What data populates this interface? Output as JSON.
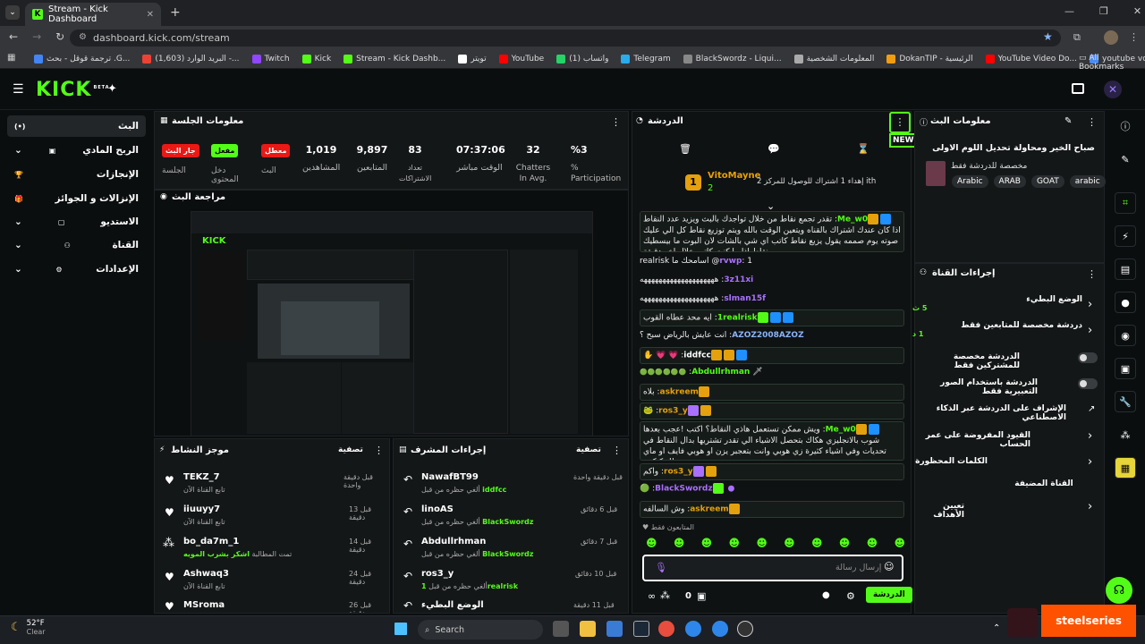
{
  "browser": {
    "tab_title": "Stream - Kick Dashboard",
    "url": "dashboard.kick.com/stream",
    "bookmarks": [
      "ترجمة قوقل - بحث .G...",
      "البريد الوارد (1,603) -...",
      "Twitch",
      "Kick",
      "Stream - Kick Dashb...",
      "تويتر",
      "YouTube",
      "واتساب (1)",
      "Telegram",
      "BlackSwordz - Liqui...",
      "المعلومات الشخصية",
      "DokanTIP - الرئيسية",
      "YouTube Video Do...",
      "youtube vod"
    ],
    "all_bookmarks": "All Bookmarks"
  },
  "brand": {
    "logo": "KICK",
    "beta": "BETA",
    "accent": "#53fc18"
  },
  "nav": {
    "items": [
      {
        "label": "البث",
        "icon": "(•)"
      },
      {
        "label": "الربح المادي",
        "icon": "▣"
      },
      {
        "label": "الإنجازات",
        "icon": "🏆"
      },
      {
        "label": "الإنزالات و الجوائز",
        "icon": "🎁"
      },
      {
        "label": "الاستديو",
        "icon": "▢"
      },
      {
        "label": "القناة",
        "icon": "⚇"
      },
      {
        "label": "الإعدادات",
        "icon": "⚙"
      }
    ]
  },
  "session": {
    "title": "معلومات الجلسة",
    "btn_live": "جار البث",
    "btn_enabled": "مفعل",
    "btn_disabled": "معطل",
    "labels": [
      "الجلسة",
      "دخل المحتوى",
      "البث"
    ],
    "stats": [
      {
        "value": "1,019",
        "label": "المشاهدين"
      },
      {
        "value": "9,897",
        "label": "المتابعين"
      },
      {
        "value": "83",
        "label": "تعداد الاشتراكات"
      },
      {
        "value": "07:37:06",
        "label": "الوقت مباشر"
      },
      {
        "value": "32",
        "label": "Chatters In Avg."
      },
      {
        "value": "%3",
        "label": "% Participation"
      }
    ]
  },
  "preview": {
    "title": "مراجعة البث"
  },
  "activity": {
    "title": "موجز النشاط",
    "filter": "تصفية",
    "rows": [
      {
        "name": "TEKZ_7",
        "sub": "تابع القناة الآن",
        "time": "قبل دقيقة واحدة",
        "icon": "heart-icon"
      },
      {
        "name": "iiuuyy7",
        "sub": "تابع القناة الآن",
        "time": "قبل 13 دقيقة",
        "icon": "heart-icon"
      },
      {
        "name": "bo_da7m_1",
        "sub": "تمت المطالبة",
        "sub2": "اشكر بشرب المويه",
        "time": "قبل 14 دقيقة",
        "icon": "dots-icon"
      },
      {
        "name": "Ashwaq3",
        "sub": "تابع القناة الآن",
        "time": "قبل 24 دقيقة",
        "icon": "heart-icon"
      },
      {
        "name": "MSroma",
        "sub": "",
        "time": "قبل 26 دقيقة",
        "icon": "heart-icon"
      }
    ]
  },
  "mod": {
    "title": "إجراءات المشرف",
    "filter": "تصفية",
    "rows": [
      {
        "name": "NawafBT99",
        "sub": "ألغي حظره من قبل",
        "by": "iddfcc",
        "time": "قبل دقيقة واحدة"
      },
      {
        "name": "linoAS",
        "sub": "ألغي حظره من قبل",
        "by": "BlackSwordz",
        "time": "قبل 6 دقائق"
      },
      {
        "name": "Abdullrhman",
        "sub": "ألغي حظره من قبل",
        "by": "BlackSwordz",
        "time": "قبل 7 دقائق"
      },
      {
        "name": "ros3_y",
        "sub": "ألغي حظره من قبل",
        "by": "1realrisk",
        "time": "قبل 10 دقائق"
      },
      {
        "name": "الوضع البطيء",
        "sub": "",
        "by": "",
        "time": "قبل 11 دقيقة"
      }
    ]
  },
  "chat": {
    "title": "الدردشة",
    "new_label": "NEW",
    "pinned_user": "VitoMayne",
    "pinned_count": "2",
    "pinned_text": "إهداء 1 اشتراك للوصول للمركز 2 ith",
    "messages": [
      {
        "user": "Me_w0",
        "color": "#53fc18",
        "text": "تقدر تجمع نقاط من خلال تواجدك بالبث ويزيد عدد النقاط اذا كان عندك اشتراك بالقناه ويتعين الوقت بالله ويتم توزيع نقاط كل الي عليك صوته يوم صممه يقول يزيع نقاط كاتب اي شي بالشات لان البوت ما بيسطيك نقاط اذا ما كنت كاتب خلال اخر دقيقة",
        "hl": true
      },
      {
        "user": "rvwp",
        "color": "#a970ff",
        "text": "1@ اسامحك ما realrisk"
      },
      {
        "user": "3z11xi",
        "color": "#a970ff",
        "text": "ههههههههههههههههههههه"
      },
      {
        "user": "slman15f",
        "color": "#a970ff",
        "text": "ههههههههههههههههههههه"
      },
      {
        "user": "1realrisk",
        "color": "#53fc18",
        "text": "ايه محد عطاه القوب",
        "hl": true
      },
      {
        "user": "AZOZ2008AZOZ",
        "color": "#a970ff",
        "text": "انت عايش بالرياض سبح ؟"
      },
      {
        "user": "iddfcc",
        "color": "#ffffff",
        "text": "💗 💗 ✋",
        "hl": true
      },
      {
        "user": "Abdullrhman",
        "color": "#53fc18",
        "text": "🟢🟢🟢🟢🟢🟢"
      },
      {
        "user": "askreem",
        "color": "#e5a00d",
        "text": "بلاه",
        "hl": true
      },
      {
        "user": "ros3_y",
        "color": "#e5a00d",
        "text": "🐸",
        "hl": true
      },
      {
        "user": "Me_w0",
        "color": "#53fc18",
        "text": "ويش ممكن تستعمل هاذي النقاط؟ اكتب !عجب بعدها شوب بالانجليزي هكاك بتحصل الاشياء الي تقدر تشتريها بدال النقاط في تحديات وفي اشياء كثيرة زي هوبي وانت بتعجبر يزن او هوبي فايف او ماي سطل كتكتي",
        "hl": true
      },
      {
        "user": "ros3_y",
        "color": "#e5a00d",
        "text": "واكم",
        "hl": true
      },
      {
        "user": "BlackSwordz",
        "color": "#a970ff",
        "text": "🟢"
      },
      {
        "user": "askreem",
        "color": "#e5a00d",
        "text": "وش السالفه",
        "hl": true
      }
    ],
    "followers_only": "المتابعون فقط",
    "input_placeholder": "إرسال رسالة",
    "send_label": "الدردشة",
    "count": "0"
  },
  "stream_info": {
    "title": "معلومات البث",
    "stream_title": "صباح الخير ومحاولة تحديل اللوم الاولى",
    "category": "مخصصة للدردشة فقط",
    "tags": [
      "Arabic",
      "ARAB",
      "GOAT",
      "arabic"
    ]
  },
  "channel_actions": {
    "title": "إجراءات القناة",
    "items": [
      {
        "label": "الوضع البطيء",
        "sub": "5 ث",
        "control": "chevron"
      },
      {
        "label": "دردشة مخصصة للمتابعين فقط",
        "sub": "1 د",
        "control": "chevron"
      },
      {
        "label": "الدردشة مخصصة للمشتركين فقط",
        "sub": "",
        "control": "toggle"
      },
      {
        "label": "الدردشة باستخدام الصور التعبيرية فقط",
        "sub": "",
        "control": "toggle"
      },
      {
        "label": "الإشراف على الدردشة عبر الذكاء الاصطناعي",
        "sub": "",
        "control": "external"
      },
      {
        "label": "القيود المفروضة على عمر الحساب",
        "sub": "",
        "control": "chevron"
      },
      {
        "label": "الكلمات المحظورة",
        "sub": "",
        "control": "chevron"
      },
      {
        "label": "القناة المضيفة",
        "sub": "",
        "control": "none"
      },
      {
        "label": "تعيين الأهداف",
        "sub": "",
        "control": "chevron"
      }
    ]
  },
  "taskbar": {
    "weather_temp": "52°F",
    "weather_desc": "Clear",
    "search": "Search",
    "steelseries": "steelseries"
  }
}
